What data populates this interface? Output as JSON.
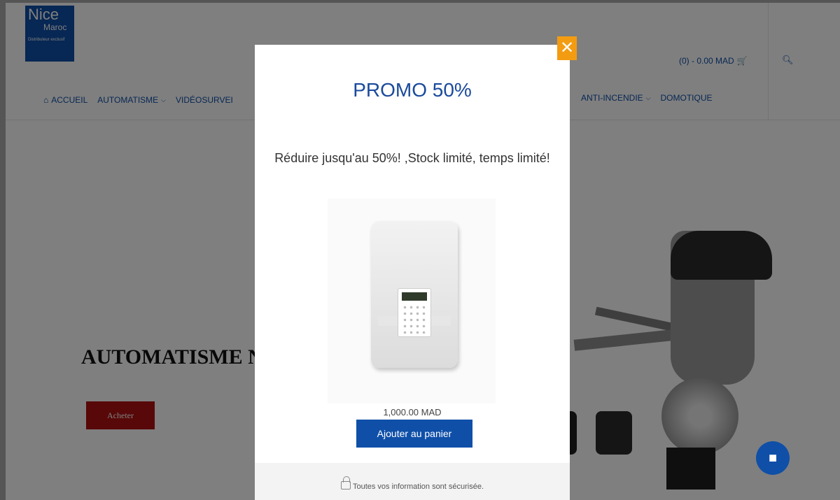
{
  "site": {
    "logo": {
      "line1": "Nice",
      "line2": "Maroc",
      "line3": "Distributeur exclusif"
    },
    "cart_label": "(0) - 0.00 MAD",
    "cart_icon": "cart-icon",
    "search_icon": "search-icon"
  },
  "nav": {
    "home_icon": "home-icon",
    "home": "ACCUEIL",
    "automatisme": "AUTOMATISME",
    "videosurveillance": "VIDÉOSURVEI",
    "anti_incendie": "ANTI-INCENDIE",
    "domotique": "DOMOTIQUE"
  },
  "hero": {
    "title": "AUTOMATISME N",
    "buy_label": "Acheter"
  },
  "modal": {
    "title": "PROMO 50%",
    "description": "Réduire jusqu'au 50%! ,Stock limité, temps limité!",
    "price": "1,000.00 MAD",
    "add_to_cart": "Ajouter au panier",
    "secure_text": "Toutes vos information sont sécurisée.",
    "close_icon": "close-icon",
    "accent_color": "#f39c12",
    "brand_color": "#0f4fa8"
  },
  "chat": {
    "icon": "chat-icon"
  }
}
